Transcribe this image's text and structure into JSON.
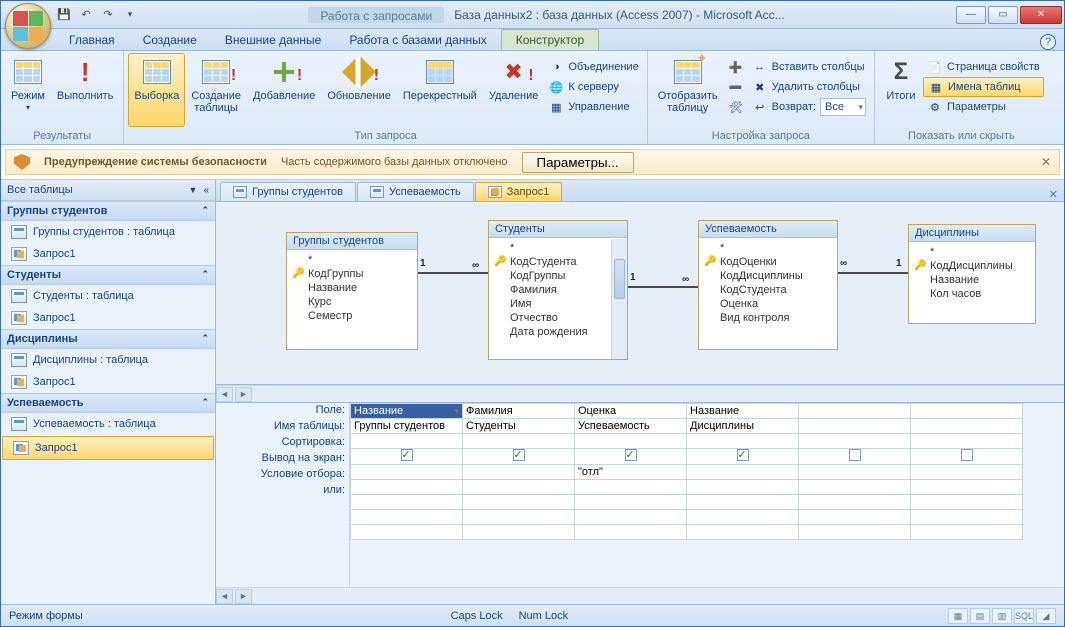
{
  "titlebar": {
    "context_title": "Работа с запросами",
    "doc_title": "База данных2 : база данных (Access 2007) - Microsoft Acc..."
  },
  "ribbon_tabs": {
    "home": "Главная",
    "create": "Создание",
    "external": "Внешние данные",
    "dbwork": "Работа с базами данных",
    "designer": "Конструктор"
  },
  "ribbon": {
    "results": {
      "mode": "Режим",
      "run": "Выполнить",
      "label": "Результаты"
    },
    "querytype": {
      "select": "Выборка",
      "maketable": "Создание\nтаблицы",
      "append": "Добавление",
      "update": "Обновление",
      "crosstab": "Перекрестный",
      "delete": "Удаление",
      "union": "Объединение",
      "server": "К серверу",
      "control": "Управление",
      "label": "Тип запроса"
    },
    "setup": {
      "showtable": "Отобразить\nтаблицу",
      "insrows_icon": "",
      "insertcols": "Вставить столбцы",
      "deletecols": "Удалить столбцы",
      "return": "Возврат:",
      "return_val": "Все",
      "label": "Настройка запроса"
    },
    "showhide": {
      "totals": "Итоги",
      "props": "Страница свойств",
      "tablenames": "Имена таблиц",
      "params": "Параметры",
      "label": "Показать или скрыть"
    }
  },
  "security": {
    "heading": "Предупреждение системы безопасности",
    "msg": "Часть содержимого базы данных отключено",
    "btn": "Параметры..."
  },
  "nav": {
    "head": "Все таблицы",
    "groups": [
      {
        "title": "Группы студентов",
        "items": [
          "Группы студентов : таблица",
          "Запрос1"
        ]
      },
      {
        "title": "Студенты",
        "items": [
          "Студенты : таблица",
          "Запрос1"
        ]
      },
      {
        "title": "Дисциплины",
        "items": [
          "Дисциплины : таблица",
          "Запрос1"
        ]
      },
      {
        "title": "Успеваемость",
        "items": [
          "Успеваемость : таблица",
          "Запрос1"
        ]
      }
    ]
  },
  "doctabs": {
    "t1": "Группы студентов",
    "t2": "Успеваемость",
    "t3": "Запрос1"
  },
  "tables": {
    "groups": {
      "title": "Группы студентов",
      "star": "*",
      "f1": "КодГруппы",
      "f2": "Название",
      "f3": "Курс",
      "f4": "Семестр"
    },
    "students": {
      "title": "Студенты",
      "star": "*",
      "f1": "КодСтудента",
      "f2": "КодГруппы",
      "f3": "Фамилия",
      "f4": "Имя",
      "f5": "Отчество",
      "f6": "Дата рождения"
    },
    "perf": {
      "title": "Успеваемость",
      "star": "*",
      "f1": "КодОценки",
      "f2": "КодДисциплины",
      "f3": "КодСтудента",
      "f4": "Оценка",
      "f5": "Вид контроля"
    },
    "disc": {
      "title": "Дисциплины",
      "star": "*",
      "f1": "КодДисциплины",
      "f2": "Название",
      "f3": "Кол часов"
    }
  },
  "rel": {
    "one": "1",
    "inf": "∞"
  },
  "grid": {
    "labels": {
      "field": "Поле:",
      "table": "Имя таблицы:",
      "sort": "Сортировка:",
      "show": "Вывод на экран:",
      "criteria": "Условие отбора:",
      "or": "или:"
    },
    "cols": [
      {
        "field": "Название",
        "table": "Группы студентов",
        "show": true,
        "criteria": ""
      },
      {
        "field": "Фамилия",
        "table": "Студенты",
        "show": true,
        "criteria": ""
      },
      {
        "field": "Оценка",
        "table": "Успеваемость",
        "show": true,
        "criteria": "\"отл\""
      },
      {
        "field": "Название",
        "table": "Дисциплины",
        "show": true,
        "criteria": ""
      },
      {
        "field": "",
        "table": "",
        "show": false,
        "criteria": ""
      },
      {
        "field": "",
        "table": "",
        "show": false,
        "criteria": ""
      }
    ]
  },
  "statusbar": {
    "mode": "Режим формы",
    "caps": "Caps Lock",
    "num": "Num Lock",
    "sql": "SQL"
  }
}
